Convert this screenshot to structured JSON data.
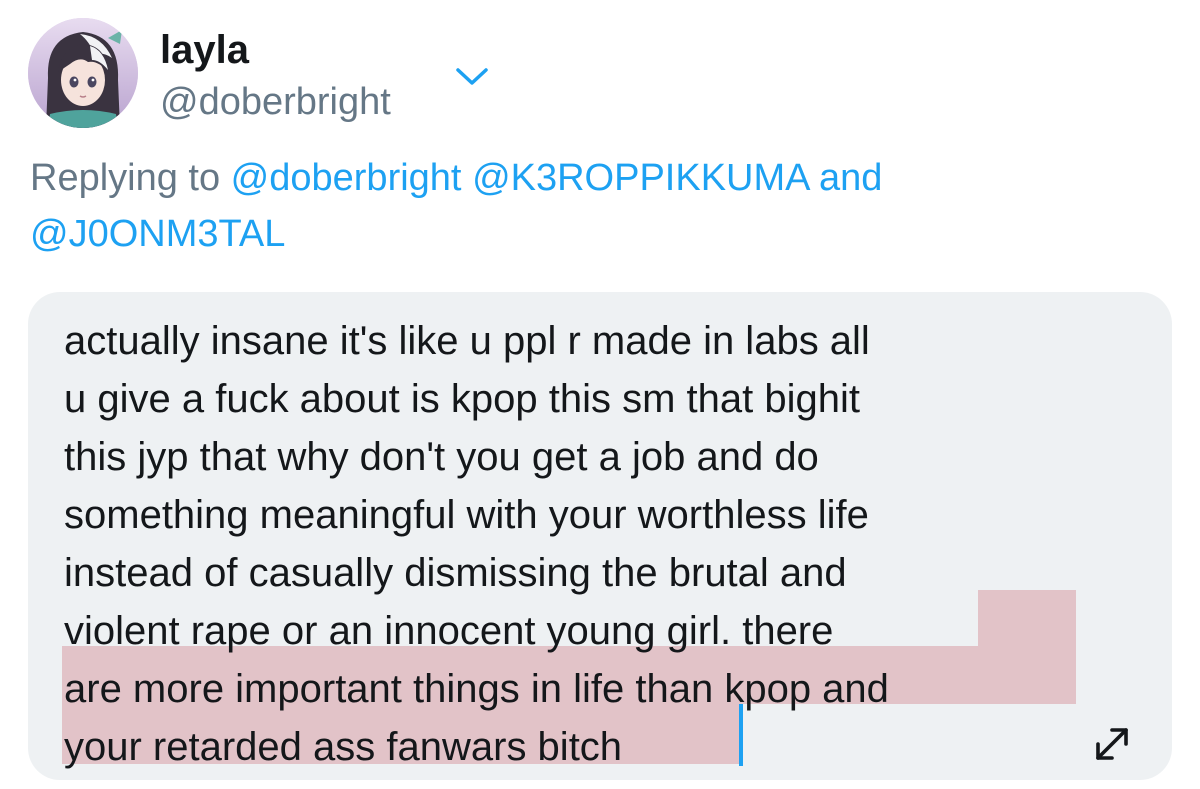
{
  "profile": {
    "display_name": "layla",
    "handle": "@doberbright",
    "avatar_icon": "anime-character-avatar"
  },
  "reply": {
    "prefix": "Replying to ",
    "mentions": [
      "@doberbright",
      "@K3ROPPIKKUMA",
      "@J0ONM3TAL"
    ],
    "separator_and": " and"
  },
  "compose": {
    "lines": [
      "actually insane it's like u ppl r made in labs all",
      "u give a fuck about is kpop this sm that bighit",
      "this jyp that why don't you get a job and do",
      "something meaningful with your worthless life",
      "instead of casually dismissing the brutal and",
      "violent rape or an innocent young girl. there",
      "are more important things in life than kpop and",
      "your retarded ass fanwars bitch"
    ],
    "expand_icon": "expand-arrows-icon"
  },
  "colors": {
    "accent": "#1da1f2",
    "secondary_text": "#657786",
    "primary_text": "#14171a",
    "compose_background": "#eef1f3",
    "overflow_highlight": "#e2c3c8"
  }
}
